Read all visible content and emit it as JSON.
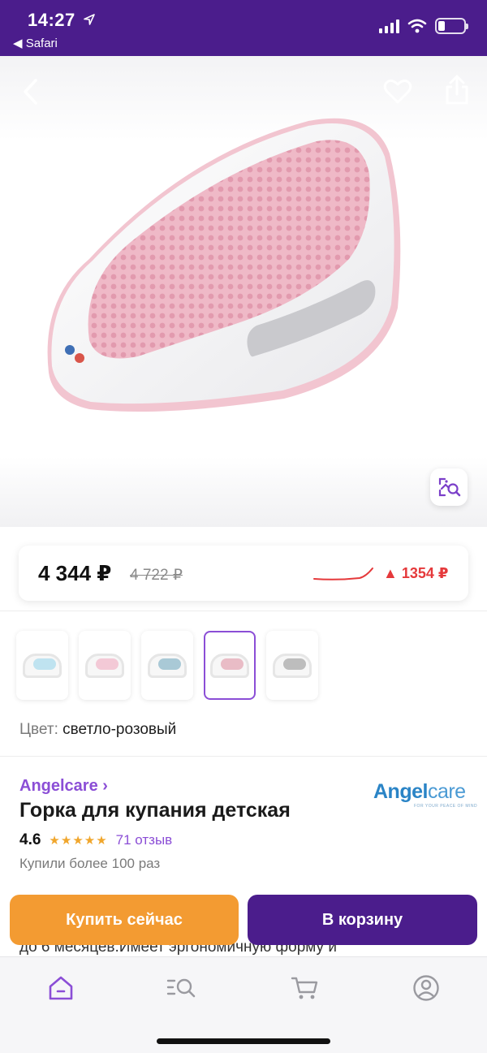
{
  "status_bar": {
    "time": "14:27",
    "back_app": "◀ Safari"
  },
  "price": {
    "current": "4 344 ₽",
    "old": "4 722 ₽",
    "change": "▲ 1354 ₽"
  },
  "colors": {
    "label": "Цвет:",
    "selected": "светло-розовый",
    "options": [
      {
        "mesh": "#bfe3f0"
      },
      {
        "mesh": "#f3c9d6"
      },
      {
        "mesh": "#a9c9d6"
      },
      {
        "mesh": "#e9bcc6"
      },
      {
        "mesh": "#bdbdbd"
      }
    ],
    "selected_index": 3
  },
  "product": {
    "brand": "Angelcare ›",
    "brand_logo_main": "Angel",
    "brand_logo_accent": "care",
    "brand_logo_tagline": "FOR YOUR PEACE OF MIND",
    "title": "Горка для купания детская",
    "rating": "4.6",
    "stars": "★★★★★",
    "reviews": "71 отзыв",
    "bought": "Купили более 100 раз",
    "description_peek": "до 6 месяцев.Имеет эргономичную форму и"
  },
  "actions": {
    "buy_now": "Купить сейчас",
    "add_to_cart": "В корзину"
  },
  "theme": {
    "primary": "#4b1d8c",
    "accent": "#8b4ed6",
    "buy": "#f39b32",
    "price_up": "#e5393b"
  },
  "tabs": [
    "home-icon",
    "catalog-search-icon",
    "cart-icon",
    "profile-icon"
  ]
}
